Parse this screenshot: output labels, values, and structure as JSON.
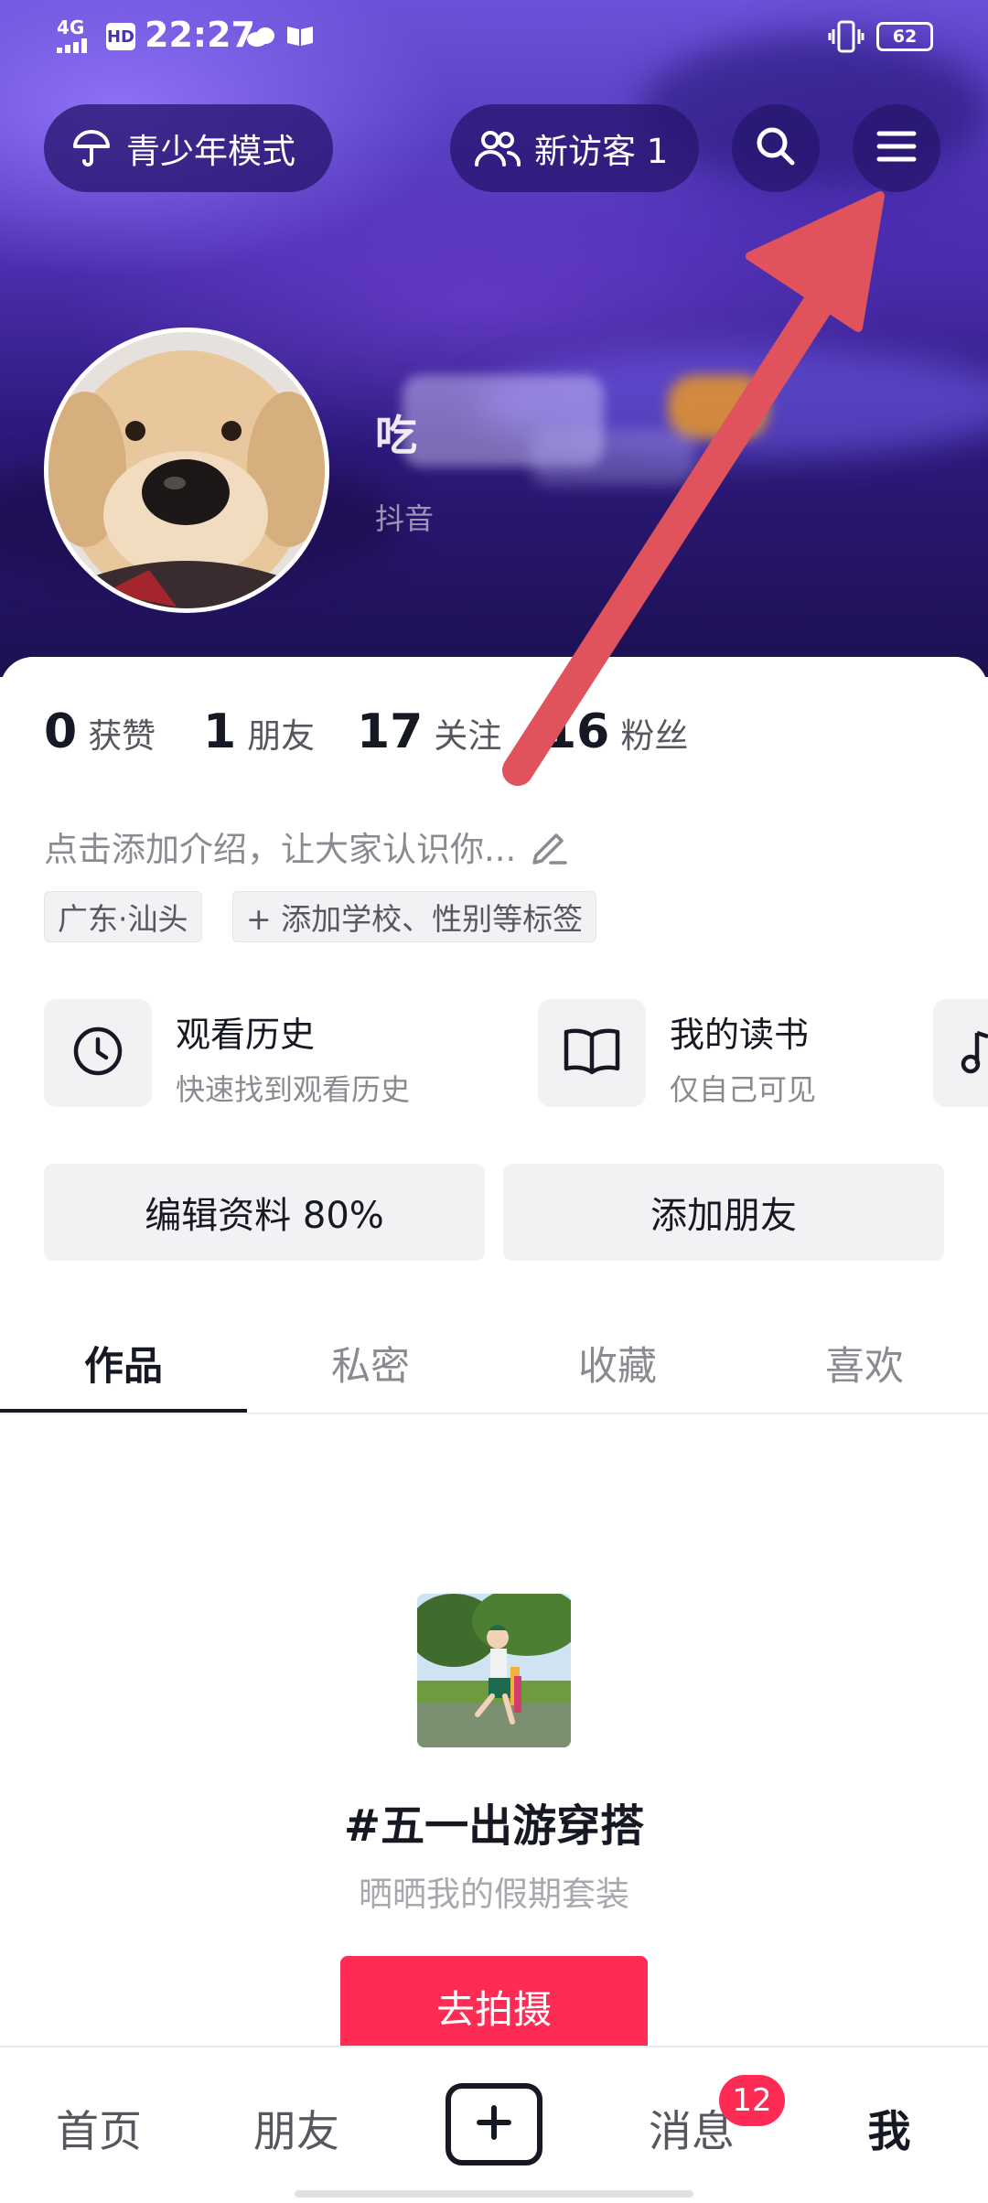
{
  "status_bar": {
    "network": "4G",
    "hd": "HD",
    "time": "22:27",
    "battery": "62"
  },
  "top_bar": {
    "teen_mode_label": "青少年模式",
    "visitors_label": "新访客 1"
  },
  "profile": {
    "display_name_partial": "吃",
    "platform_label": "抖音",
    "stats": [
      {
        "num": "0",
        "label": "获赞"
      },
      {
        "num": "1",
        "label": "朋友"
      },
      {
        "num": "17",
        "label": "关注"
      },
      {
        "num": "16",
        "label": "粉丝"
      }
    ],
    "intro_placeholder": "点击添加介绍，让大家认识你...",
    "location_tag": "广东·汕头",
    "add_tags_label": "+ 添加学校、性别等标签"
  },
  "services": [
    {
      "title": "观看历史",
      "subtitle": "快速找到观看历史",
      "icon": "clock-icon"
    },
    {
      "title": "我的读书",
      "subtitle": "仅自己可见",
      "icon": "book-icon"
    },
    {
      "title": "",
      "subtitle": "",
      "icon": "music-icon"
    }
  ],
  "actions": {
    "edit_profile": "编辑资料 80%",
    "add_friends": "添加朋友"
  },
  "tabs": [
    "作品",
    "私密",
    "收藏",
    "喜欢"
  ],
  "active_tab": "作品",
  "promo": {
    "hashtag": "#五一出游穿搭",
    "subtitle": "晒晒我的假期套装",
    "button": "去拍摄"
  },
  "bottom_nav": {
    "home": "首页",
    "friends": "朋友",
    "messages": "消息",
    "messages_badge": "12",
    "me": "我"
  },
  "colors": {
    "accent_red": "#fe2c55",
    "arrow": "#e0525c"
  }
}
